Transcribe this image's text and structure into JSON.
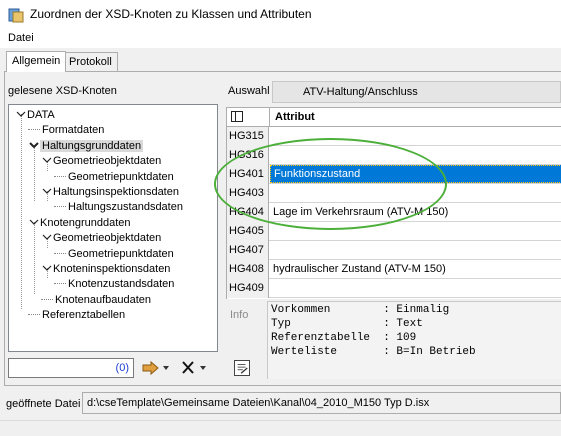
{
  "window": {
    "title": "Zuordnen der XSD-Knoten zu Klassen und Attributen"
  },
  "menu": {
    "items": [
      "Datei"
    ]
  },
  "tabs": [
    {
      "label": "Allgemein",
      "active": true
    },
    {
      "label": "Protokoll",
      "active": false
    }
  ],
  "left": {
    "header": "gelesene XSD-Knoten",
    "tree": [
      {
        "label": "DATA",
        "level": 0,
        "expand": "open"
      },
      {
        "label": "Formatdaten",
        "level": 1,
        "expand": "none"
      },
      {
        "label": "Haltungsgrunddaten",
        "level": 1,
        "expand": "bold-open",
        "selected": true
      },
      {
        "label": "Geometrieobjektdaten",
        "level": 2,
        "expand": "open"
      },
      {
        "label": "Geometriepunktdaten",
        "level": 3,
        "expand": "none"
      },
      {
        "label": "Haltungsinspektionsdaten",
        "level": 2,
        "expand": "open"
      },
      {
        "label": "Haltungszustandsdaten",
        "level": 3,
        "expand": "none"
      },
      {
        "label": "Knotengrunddaten",
        "level": 1,
        "expand": "open"
      },
      {
        "label": "Geometrieobjektdaten",
        "level": 2,
        "expand": "open"
      },
      {
        "label": "Geometriepunktdaten",
        "level": 3,
        "expand": "none"
      },
      {
        "label": "Knoteninspektionsdaten",
        "level": 2,
        "expand": "open"
      },
      {
        "label": "Knotenzustandsdaten",
        "level": 3,
        "expand": "none"
      },
      {
        "label": "Knotenaufbaudaten",
        "level": 2,
        "expand": "none"
      },
      {
        "label": "Referenztabellen",
        "level": 1,
        "expand": "none"
      }
    ],
    "count": "(0)"
  },
  "right": {
    "auswahl_label": "Auswahl",
    "auswahl_value": "ATV-Haltung/Anschluss",
    "grid_header": "Attribut",
    "rows": [
      {
        "key": "HG315",
        "value": ""
      },
      {
        "key": "HG316",
        "value": ""
      },
      {
        "key": "HG401",
        "value": "Funktionszustand",
        "selected": true
      },
      {
        "key": "HG403",
        "value": ""
      },
      {
        "key": "HG404",
        "value": "Lage im Verkehrsraum (ATV-M 150)"
      },
      {
        "key": "HG405",
        "value": ""
      },
      {
        "key": "HG407",
        "value": ""
      },
      {
        "key": "HG408",
        "value": "hydraulischer Zustand (ATV-M 150)"
      },
      {
        "key": "HG409",
        "value": ""
      }
    ],
    "info_label": "Info",
    "info_lines": [
      "Vorkommen        : Einmalig",
      "Typ              : Text",
      "Referenztabelle  : 109",
      "Werteliste       : B=In Betrieb"
    ]
  },
  "footer": {
    "file_label": "geöffnete Datei",
    "file_path": "d:\\cseTemplate\\Gemeinsame Dateien\\Kanal\\04_2010_M150 Typ D.isx"
  },
  "colors": {
    "selection": "#0078d7",
    "highlight": "#4caf3a",
    "count_text": "#1c3fd1"
  },
  "icons": [
    "app-icon",
    "table-columns-icon",
    "arrow-right-icon",
    "dropdown-icon",
    "delete-x-icon",
    "document-edit-icon"
  ]
}
